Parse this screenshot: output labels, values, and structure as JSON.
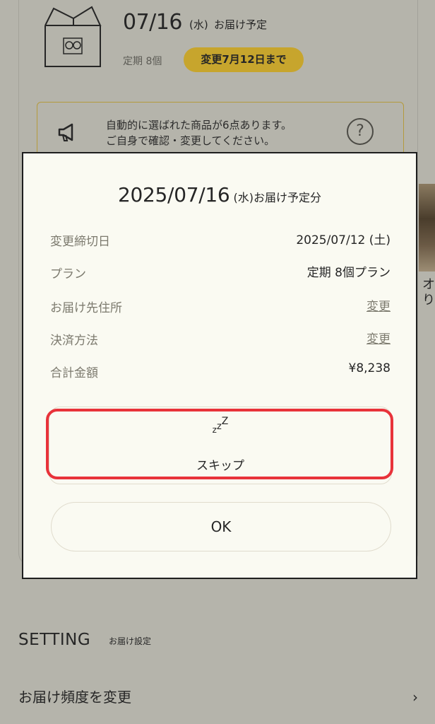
{
  "delivery": {
    "date": "07/16",
    "dow": "(水)",
    "suffix": "お届け予定",
    "plan": "定期 8個",
    "deadline_badge": "変更7月12日まで"
  },
  "notice": {
    "line1": "自動的に選ばれた商品が6点あります。",
    "line2": "ご自身で確認・変更してください。",
    "help_symbol": "?"
  },
  "side_product": {
    "text": "オり"
  },
  "setting": {
    "title": "SETTING",
    "subtitle": "お届け設定",
    "frequency_label": "お届け頻度を変更",
    "chevron": "›"
  },
  "modal": {
    "title_date": "2025/07/16",
    "title_dow": "(水)",
    "title_suffix": "お届け予定分",
    "rows": [
      {
        "label": "変更締切日",
        "value": "2025/07/12 (土)"
      },
      {
        "label": "プラン",
        "value": "定期 8個プラン"
      },
      {
        "label": "お届け先住所",
        "value": "変更"
      },
      {
        "label": "決済方法",
        "value": "変更"
      },
      {
        "label": "合計金額",
        "value": "¥8,238"
      }
    ],
    "skip_icon": "zzZ",
    "skip_label": "スキップ",
    "ok_label": "OK"
  },
  "colors": {
    "background": "#b5b4ab",
    "modal_bg": "#fafaf2",
    "badge": "#c7a52d",
    "highlight": "#e8323a"
  }
}
